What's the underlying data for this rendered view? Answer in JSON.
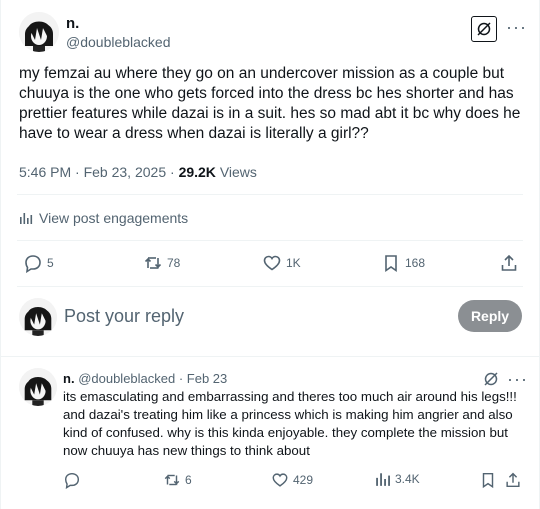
{
  "post": {
    "author_name": "n.",
    "author_handle": "@doubleblacked",
    "text": "my femzai au where they go on an undercover mission as a couple but chuuya is the one who gets forced into the dress bc hes shorter and has prettier features while dazai is in a suit. hes so mad abt it bc why does he have to wear a dress when dazai is literally a girl??",
    "time": "5:46 PM",
    "date": "Feb 23, 2025",
    "views_count": "29.2K",
    "views_label": "Views",
    "engagements_link": "View post engagements",
    "actions": {
      "replies": "5",
      "reposts": "78",
      "likes": "1K",
      "bookmarks": "168"
    }
  },
  "composer": {
    "placeholder": "Post your reply",
    "button_label": "Reply"
  },
  "reply": {
    "author_name": "n.",
    "author_handle": "@doubleblacked",
    "date": "Feb 23",
    "text": "its emasculating and embarrassing and theres too much air around his legs!!! and dazai's treating him like a princess which is making him angrier and also kind of confused. why is this kinda enjoyable. they complete the mission but now chuuya has new things to think about",
    "actions": {
      "replies": "",
      "reposts": "6",
      "likes": "429",
      "views": "3.4K"
    }
  },
  "icons": [
    "grok-icon",
    "more-icon",
    "analytics-icon",
    "reply-icon",
    "repost-icon",
    "like-icon",
    "bookmark-icon",
    "share-icon"
  ],
  "colors": {
    "text": "#0f1419",
    "muted": "#536471",
    "divider": "#eff3f4",
    "reply_button": "#8b8f93"
  }
}
